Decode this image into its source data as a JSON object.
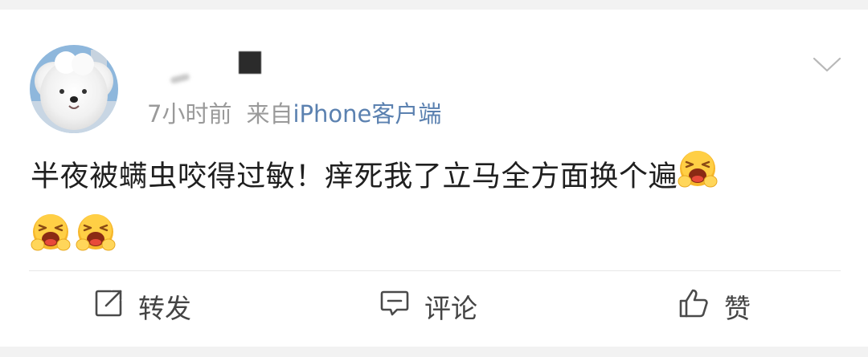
{
  "post": {
    "author": {
      "avatar_icon": "white-dog-avatar",
      "name_obscured": true
    },
    "meta": {
      "time": "7小时前",
      "source_prefix": "来自",
      "source_name": "iPhone客户端"
    },
    "menu_icon": "chevron-down-icon",
    "text": "半夜被螨虫咬得过敏！痒死我了立马全方面换个遍",
    "emoji_icon": "crying-face-emoji",
    "emoji_count": 3
  },
  "actions": {
    "repost": {
      "label": "转发",
      "icon": "share-icon"
    },
    "comment": {
      "label": "评论",
      "icon": "comment-icon"
    },
    "like": {
      "label": "赞",
      "icon": "thumbs-up-icon"
    }
  },
  "colors": {
    "background": "#f2f2f2",
    "card": "#ffffff",
    "text": "#1f1f1f",
    "meta": "#9a9a9a",
    "source_link": "#5b81b0",
    "emoji_yellow": "#f7b72b"
  }
}
